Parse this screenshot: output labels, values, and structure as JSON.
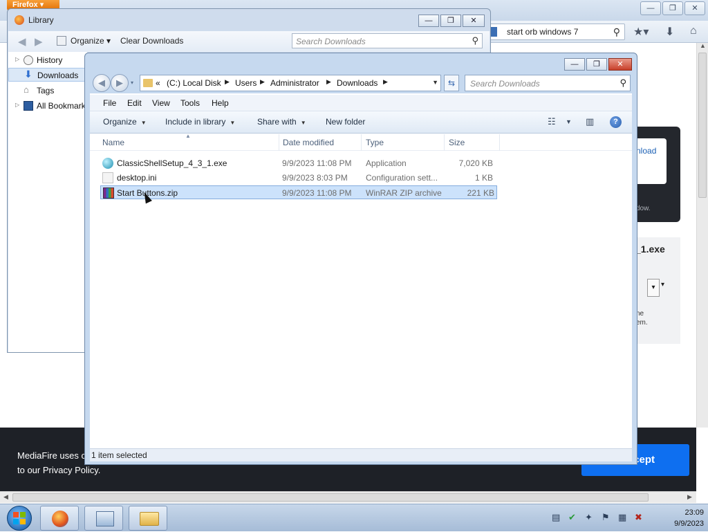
{
  "firefox": {
    "app_button": "Firefox",
    "url_text": "start  orb windows 7"
  },
  "mediafire": {
    "download_btn_fragment": "nload",
    "hint_fragment": "dow.",
    "filename_fragment": "_1.exe",
    "note_line1": "ne",
    "note_line2": "em.",
    "cookie_line1": "MediaFire uses c",
    "cookie_line2": "to our Privacy Policy.",
    "accept_fragment": "cept"
  },
  "library": {
    "title": "Library",
    "organize": "Organize",
    "clear_downloads": "Clear Downloads",
    "search_placeholder": "Search Downloads",
    "sidebar": [
      {
        "label": "History",
        "icon": "clock-icon",
        "expandable": true
      },
      {
        "label": "Downloads",
        "icon": "download-arrow-icon",
        "selected": true
      },
      {
        "label": "Tags",
        "icon": "tag-icon"
      },
      {
        "label": "All Bookmarks",
        "icon": "bookmarks-icon",
        "expandable": true
      }
    ]
  },
  "explorer": {
    "address": [
      "«",
      "(C:) Local Disk",
      "Users",
      "Administrator",
      "Downloads"
    ],
    "search_placeholder": "Search Downloads",
    "menu": [
      "File",
      "Edit",
      "View",
      "Tools",
      "Help"
    ],
    "commands": [
      "Organize",
      "Include in library",
      "Share with",
      "New folder"
    ],
    "columns": [
      "Name",
      "Date modified",
      "Type",
      "Size"
    ],
    "files": [
      {
        "name": "ClassicShellSetup_4_3_1.exe",
        "date": "9/9/2023 11:08 PM",
        "type": "Application",
        "size": "7,020 KB",
        "icon": "exe-icon"
      },
      {
        "name": "desktop.ini",
        "date": "9/9/2023 8:03 PM",
        "type": "Configuration sett...",
        "size": "1 KB",
        "icon": "ini-icon"
      },
      {
        "name": "Start Buttons.zip",
        "date": "9/9/2023 11:08 PM",
        "type": "WinRAR ZIP archive",
        "size": "221 KB",
        "icon": "zip-icon",
        "selected": true
      }
    ],
    "status": "1 item selected"
  },
  "taskbar": {
    "time": "23:09",
    "date": "9/9/2023"
  }
}
